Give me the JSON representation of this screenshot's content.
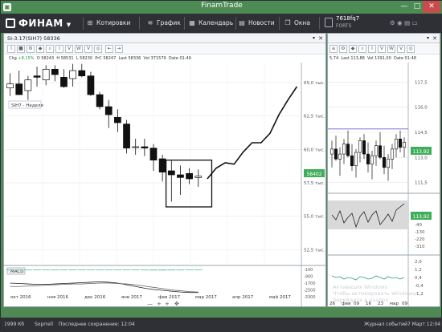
{
  "window": {
    "title": "FinamTrade",
    "minimize": "—",
    "restore": "□",
    "close": "✕"
  },
  "menu": {
    "logo_text": "ФИНАМ",
    "items": [
      {
        "label": "Котировки",
        "icon": "grid-icon",
        "glyph": "⊞"
      },
      {
        "label": "График",
        "icon": "chart-icon",
        "glyph": "≋"
      },
      {
        "label": "Календарь",
        "icon": "calendar-icon",
        "glyph": "▦"
      },
      {
        "label": "Новости",
        "icon": "news-icon",
        "glyph": "▤"
      },
      {
        "label": "Окна",
        "icon": "windows-icon",
        "glyph": "❐"
      }
    ],
    "account_name": "7618fq7",
    "account_type": "FORTS"
  },
  "left_panel": {
    "title": "SI-3.17(SIH7) 58336",
    "info": {
      "chg_label": "Chg",
      "chg": "+8,15%",
      "o_label": "O",
      "o": "58243",
      "h_label": "H",
      "h": "58531",
      "l_label": "L",
      "l": "58230",
      "prc_label": "PrC",
      "prc": "58247",
      "last_label": "Last",
      "last": "58336",
      "vol_label": "Vol",
      "vol": "371579",
      "date_label": "Date",
      "date": "01:49"
    },
    "legend": "SIH7 - Неделя",
    "current_price_tag": "58402",
    "macd_label": "MACD",
    "toolbar": [
      "I",
      "■",
      "⚙",
      "◆",
      "⌕",
      "I",
      "V",
      "W",
      "V",
      "◎",
      "⇤",
      "⇥"
    ]
  },
  "right_panel": {
    "info": {
      "last": "5,74",
      "l_label": "Last",
      "l": "113,88",
      "vol_label": "Vol",
      "vol": "1391,00",
      "date_label": "Date",
      "date": "01:48"
    },
    "toolbar": [
      "≡",
      "⚙",
      "◆",
      "⌕",
      "I",
      "V",
      "W",
      "V",
      "◎"
    ]
  },
  "chart_data": [
    {
      "type": "candlestick",
      "title": "SI-3.17(SIH7) 58336",
      "period": "Неделя",
      "x_ticks": [
        "окт 2016",
        "ноя 2016",
        "дек 2016",
        "янв 2017",
        "фев 2017",
        "мар 2017",
        "апр 2017",
        "май 2017"
      ],
      "y_ticks": [
        "65,0 тыс.",
        "62,5 тыс.",
        "60,0 тыс.",
        "57,5 тыс.",
        "55,0 тыс.",
        "52,5 тыс."
      ],
      "ylim": [
        51500,
        66500
      ],
      "candles": [
        {
          "o": 64600,
          "h": 65700,
          "l": 64000,
          "c": 64900
        },
        {
          "o": 64900,
          "h": 65900,
          "l": 64200,
          "c": 64100
        },
        {
          "o": 64400,
          "h": 65500,
          "l": 63700,
          "c": 65200
        },
        {
          "o": 65500,
          "h": 66200,
          "l": 64700,
          "c": 65400
        },
        {
          "o": 65200,
          "h": 66300,
          "l": 64800,
          "c": 66000
        },
        {
          "o": 66000,
          "h": 66300,
          "l": 65100,
          "c": 65600
        },
        {
          "o": 65400,
          "h": 66000,
          "l": 64600,
          "c": 64700
        },
        {
          "o": 65300,
          "h": 66400,
          "l": 64700,
          "c": 65900
        },
        {
          "o": 65900,
          "h": 66400,
          "l": 65400,
          "c": 65500
        },
        {
          "o": 65500,
          "h": 65800,
          "l": 64000,
          "c": 64100
        },
        {
          "o": 64100,
          "h": 64300,
          "l": 63000,
          "c": 63200
        },
        {
          "o": 63200,
          "h": 63700,
          "l": 61600,
          "c": 62600
        },
        {
          "o": 62400,
          "h": 63000,
          "l": 61300,
          "c": 62000
        },
        {
          "o": 61900,
          "h": 62200,
          "l": 59700,
          "c": 60100
        },
        {
          "o": 60200,
          "h": 60800,
          "l": 59600,
          "c": 60200
        },
        {
          "o": 60200,
          "h": 60800,
          "l": 59500,
          "c": 60100
        },
        {
          "o": 60100,
          "h": 60400,
          "l": 58400,
          "c": 59200
        },
        {
          "o": 59300,
          "h": 59600,
          "l": 57600,
          "c": 58300
        },
        {
          "o": 58400,
          "h": 59200,
          "l": 56100,
          "c": 58100
        },
        {
          "o": 58100,
          "h": 58800,
          "l": 56600,
          "c": 57900
        },
        {
          "o": 58200,
          "h": 58600,
          "l": 57400,
          "c": 57800
        },
        {
          "o": 57900,
          "h": 58500,
          "l": 57200,
          "c": 58000
        }
      ],
      "forecast_line": [
        {
          "i": 22,
          "v": 57800
        },
        {
          "i": 23,
          "v": 58600
        },
        {
          "i": 24,
          "v": 59000
        },
        {
          "i": 25,
          "v": 58900
        },
        {
          "i": 26,
          "v": 59800
        },
        {
          "i": 27,
          "v": 60500
        },
        {
          "i": 28,
          "v": 60500
        },
        {
          "i": 29,
          "v": 61200
        },
        {
          "i": 30,
          "v": 62600
        },
        {
          "i": 31,
          "v": 63700
        },
        {
          "i": 32,
          "v": 64700
        }
      ],
      "highlight_box": {
        "from_index": 18,
        "to_index": 22
      },
      "macd": {
        "y_ticks": [
          "-100",
          "-900",
          "-1700",
          "-2500",
          "-3300"
        ],
        "histogram": [
          -100,
          -120,
          -150,
          -160,
          -180,
          -200,
          -150,
          -120,
          -100,
          -90,
          -110,
          -130,
          -150,
          -160,
          -170,
          -200,
          -230,
          -250,
          -220,
          -200,
          -180,
          -160
        ],
        "macd_line": [
          -1700,
          -1750,
          -1800,
          -1850,
          -1850,
          -1800,
          -1750,
          -1700,
          -1650,
          -1600,
          -1550,
          -1600,
          -1700,
          -1900,
          -2100,
          -2300,
          -2450,
          -2550,
          -2650,
          -2750,
          -2800,
          -2800
        ],
        "signal_line": [
          -2100,
          -2100,
          -2050,
          -2000,
          -1950,
          -1900,
          -1850,
          -1800,
          -1800,
          -1750,
          -1700,
          -1700,
          -1750,
          -1800,
          -1900,
          -2050,
          -2200,
          -2350,
          -2500,
          -2600,
          -2700,
          -2750
        ]
      }
    },
    {
      "type": "candlestick",
      "title": "",
      "x_ticks": [
        "26",
        "фев",
        "09",
        "16",
        "23",
        "мар",
        "09"
      ],
      "y_ticks": [
        "117,5",
        "116,0",
        "114,5",
        "113,0",
        "111,5"
      ],
      "ylim": [
        111000,
        118000
      ],
      "price_tag": "113,92",
      "resistance": 114.7,
      "candles": [
        {
          "o": 113.2,
          "h": 114.0,
          "l": 112.4,
          "c": 113.5
        },
        {
          "o": 113.5,
          "h": 114.3,
          "l": 112.8,
          "c": 112.9
        },
        {
          "o": 112.9,
          "h": 113.6,
          "l": 111.9,
          "c": 113.2
        },
        {
          "o": 113.2,
          "h": 114.1,
          "l": 112.6,
          "c": 113.8
        },
        {
          "o": 113.8,
          "h": 114.6,
          "l": 113.0,
          "c": 113.1
        },
        {
          "o": 113.1,
          "h": 113.8,
          "l": 112.2,
          "c": 112.5
        },
        {
          "o": 112.5,
          "h": 113.5,
          "l": 111.8,
          "c": 113.3
        },
        {
          "o": 113.3,
          "h": 114.2,
          "l": 112.7,
          "c": 114.0
        },
        {
          "o": 114.0,
          "h": 114.4,
          "l": 112.9,
          "c": 113.2
        },
        {
          "o": 113.2,
          "h": 113.9,
          "l": 112.1,
          "c": 112.6
        },
        {
          "o": 112.6,
          "h": 113.4,
          "l": 111.7,
          "c": 113.1
        },
        {
          "o": 113.1,
          "h": 114.0,
          "l": 112.5,
          "c": 113.7
        },
        {
          "o": 113.7,
          "h": 114.5,
          "l": 112.9,
          "c": 113.0
        },
        {
          "o": 113.0,
          "h": 113.7,
          "l": 112.0,
          "c": 112.4
        },
        {
          "o": 112.4,
          "h": 113.2,
          "l": 111.6,
          "c": 112.9
        },
        {
          "o": 112.9,
          "h": 113.8,
          "l": 112.3,
          "c": 113.5
        },
        {
          "o": 113.5,
          "h": 114.4,
          "l": 113.0,
          "c": 114.1
        },
        {
          "o": 114.1,
          "h": 114.6,
          "l": 113.3,
          "c": 113.6
        },
        {
          "o": 113.6,
          "h": 114.2,
          "l": 113.0,
          "c": 113.9
        }
      ],
      "indicator1": {
        "price_tag": "113,92",
        "y_ticks": [
          "-40",
          "-130",
          "-220",
          "-310"
        ]
      },
      "indicator2": {
        "y_ticks": [
          "2,0",
          "1,2",
          "0,4",
          "-0,4",
          "-1,2"
        ]
      }
    }
  ],
  "status": {
    "version": "1999 Кб",
    "connection": "Soprrell",
    "saved": "Последнее сохранение: 12:04",
    "journal": "Журнал событий",
    "time": "7 Март 12:04"
  },
  "watermark": {
    "line1": "Активация Windows",
    "line2": "Чтобы активировать Windows, перейдите в раздел"
  }
}
